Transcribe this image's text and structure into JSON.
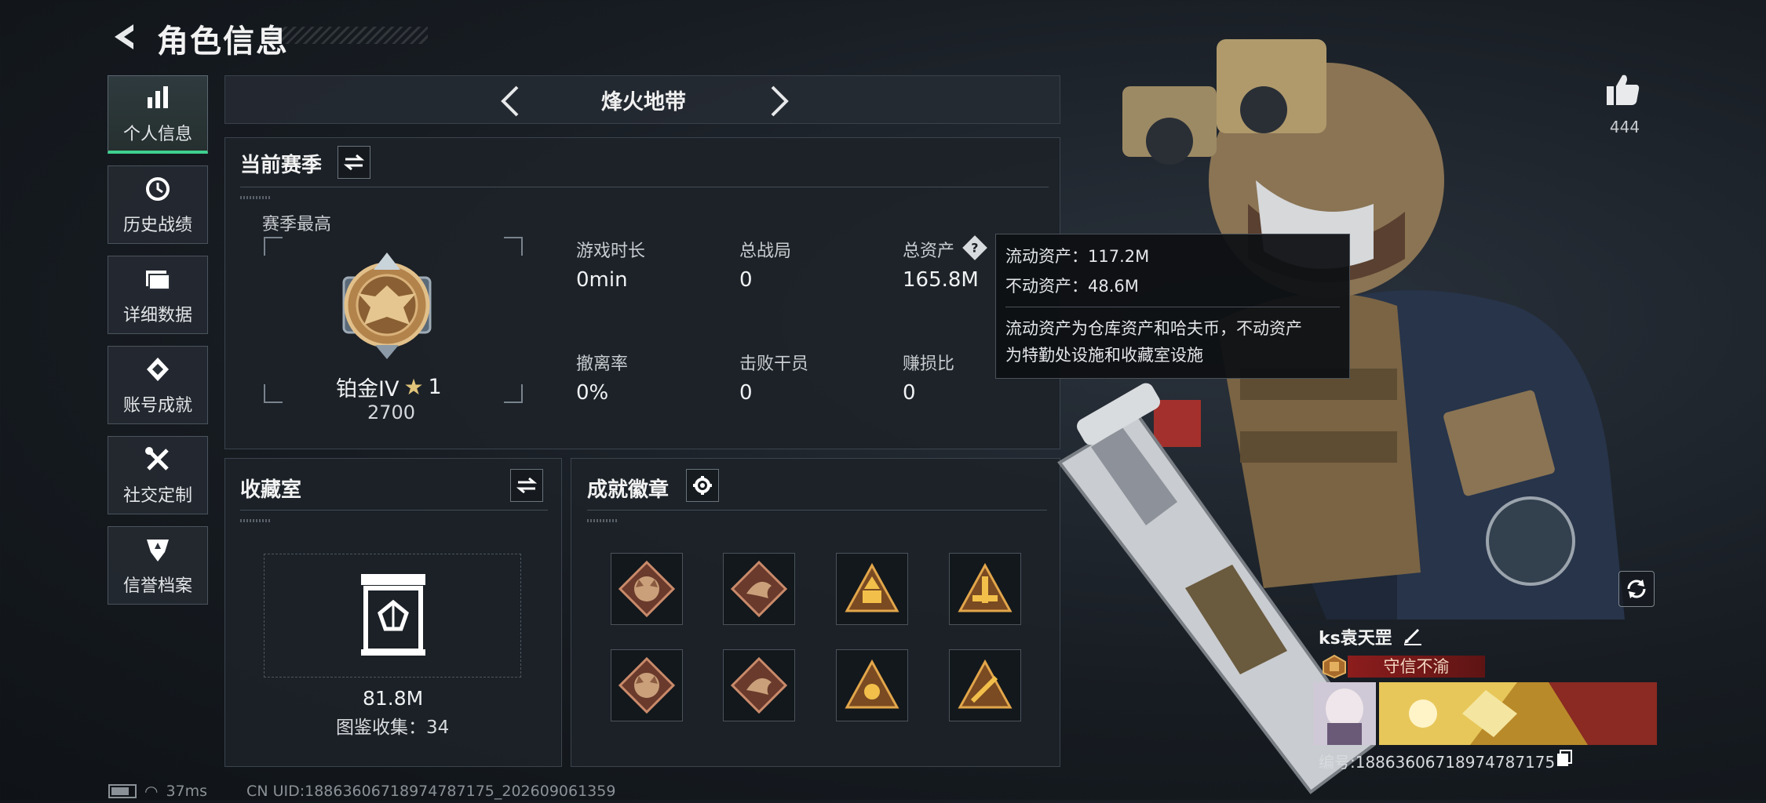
{
  "header": {
    "title": "角色信息"
  },
  "nav": {
    "items": [
      {
        "label": "个人信息",
        "icon": "bar-chart-icon",
        "active": true
      },
      {
        "label": "历史战绩",
        "icon": "history-icon",
        "active": false
      },
      {
        "label": "详细数据",
        "icon": "folder-icon",
        "active": false
      },
      {
        "label": "账号成就",
        "icon": "achievement-icon",
        "active": false
      },
      {
        "label": "社交定制",
        "icon": "tools-icon",
        "active": false
      },
      {
        "label": "信誉档案",
        "icon": "reputation-icon",
        "active": false
      }
    ]
  },
  "mode": {
    "title": "烽火地带"
  },
  "season": {
    "title": "当前赛季",
    "best_label": "赛季最高",
    "rank_name": "铂金IV",
    "rank_stars": "1",
    "rank_score": "2700",
    "stats": [
      {
        "label": "游戏时长",
        "value": "0min"
      },
      {
        "label": "总战局",
        "value": "0"
      },
      {
        "label": "总资产",
        "value": "165.8M"
      },
      {
        "label": "撤离率",
        "value": "0%"
      },
      {
        "label": "击败干员",
        "value": "0"
      },
      {
        "label": "赚损比",
        "value": "0"
      }
    ]
  },
  "tooltip": {
    "liquid": "流动资产：117.2M",
    "fixed": "不动资产：48.6M",
    "note_line1": "流动资产为仓库资产和哈夫币，不动资产",
    "note_line2": "为特勤处设施和收藏室设施"
  },
  "collection": {
    "title": "收藏室",
    "value": "81.8M",
    "count": "图鉴收集：34"
  },
  "badges": {
    "title": "成就徽章",
    "items": [
      "wolf-badge-icon",
      "dragon-badge-icon",
      "gold-pyramid-badge-icon",
      "rocket-badge-icon",
      "wolf-badge-icon",
      "dragon-badge-icon",
      "gold-pyramid-badge-icon",
      "arrow-badge-icon"
    ]
  },
  "profile": {
    "likes": "444",
    "name": "ks袁天罡",
    "title_text": "守信不渝",
    "uid": "编号:1886360671897478717​5"
  },
  "status": {
    "ping": "37ms",
    "uid_line": "CN UID:1886360671897478717​5_202609061359"
  },
  "colors": {
    "accent_green": "#3fd08f",
    "title_red": "#8c1d1d",
    "gold": "#c9a05a"
  }
}
